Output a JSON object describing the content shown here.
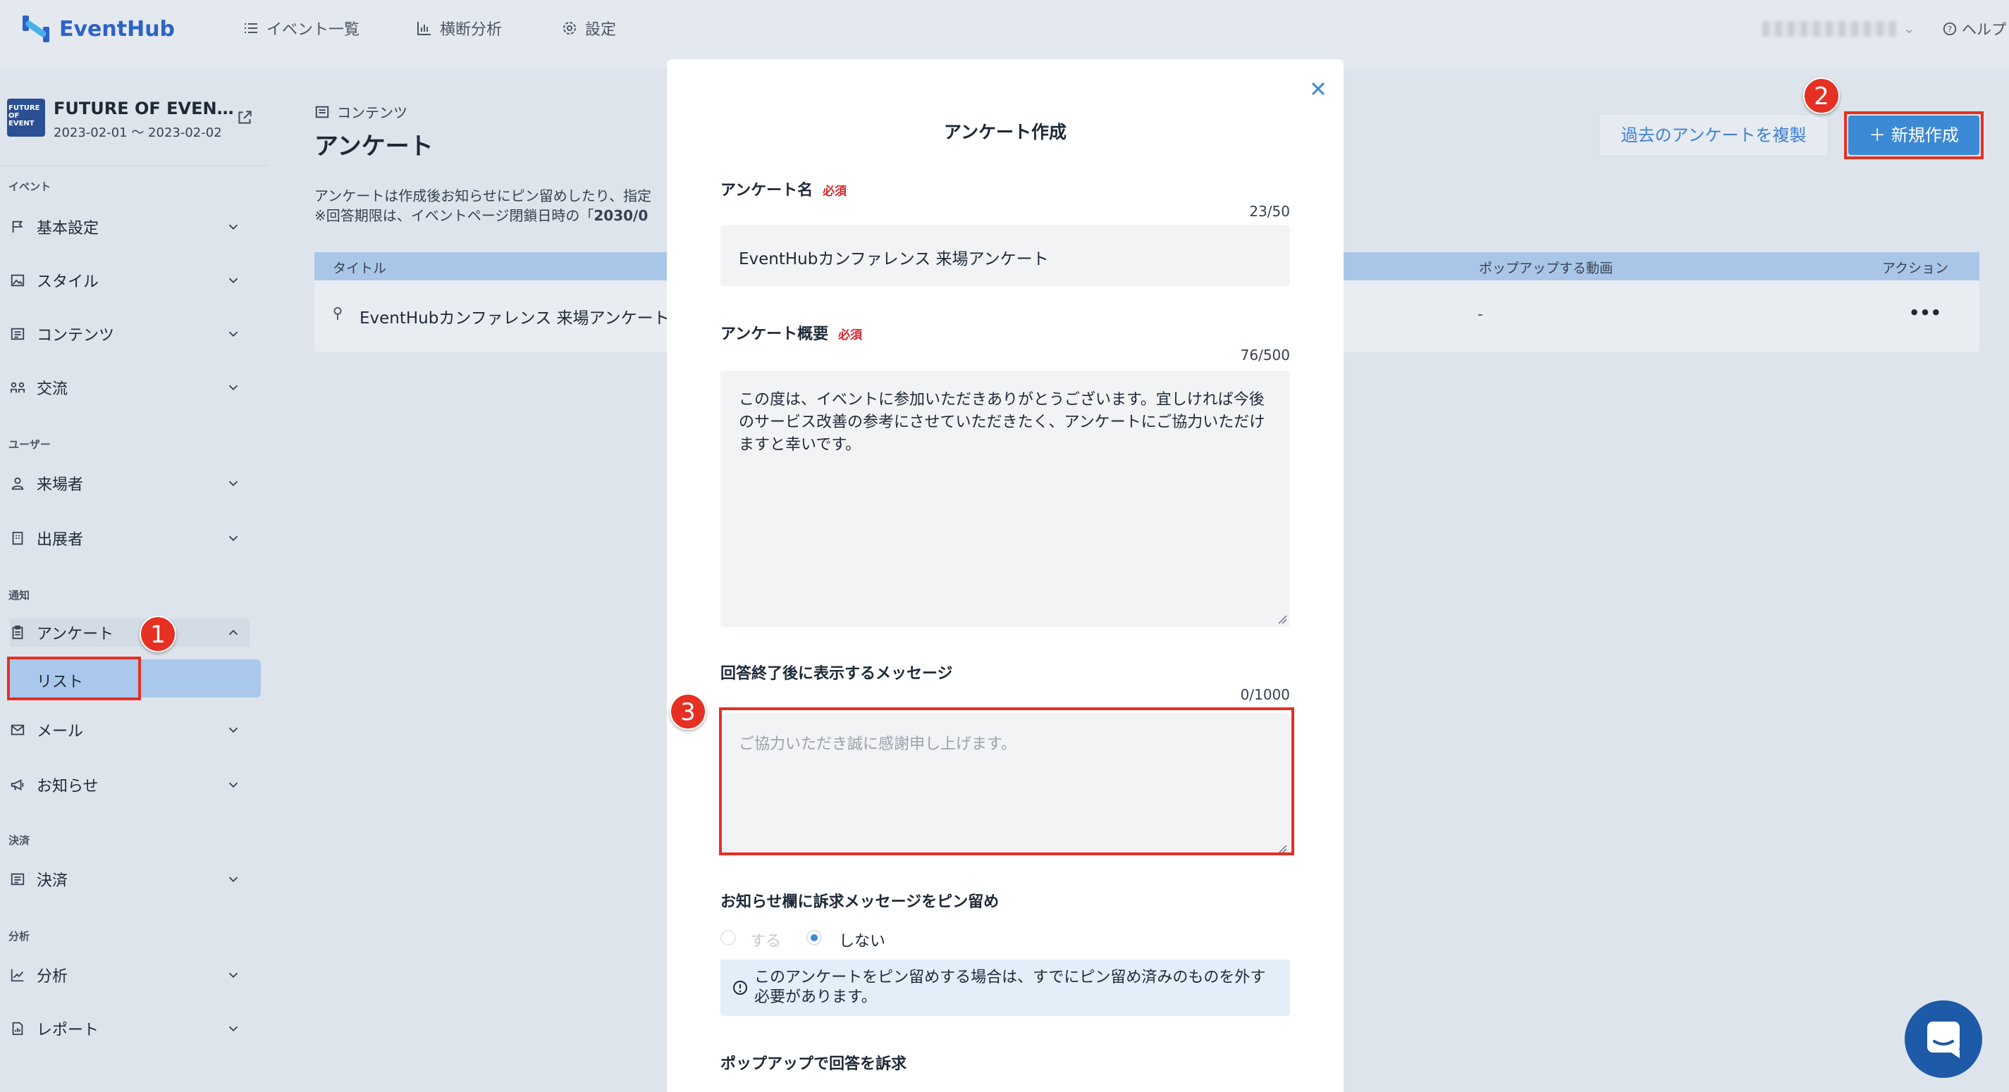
{
  "header": {
    "logo_text": "EventHub",
    "nav": [
      {
        "label": "イベント一覧",
        "icon": "list-icon"
      },
      {
        "label": "横断分析",
        "icon": "bar-chart-icon"
      },
      {
        "label": "設定",
        "icon": "gear-icon"
      }
    ],
    "help_label": "ヘルプ"
  },
  "event": {
    "thumb_text": "FUTURE OF EVENT",
    "title": "FUTURE OF EVEN…",
    "dates": "2023-02-01 ～ 2023-02-02"
  },
  "sidebar": {
    "sections": [
      {
        "label": "イベント"
      },
      {
        "label": "ユーザー"
      },
      {
        "label": "通知"
      },
      {
        "label": "決済"
      },
      {
        "label": "分析"
      }
    ],
    "items": [
      {
        "label": "基本設定",
        "icon": "flag-icon"
      },
      {
        "label": "スタイル",
        "icon": "image-icon"
      },
      {
        "label": "コンテンツ",
        "icon": "content-icon"
      },
      {
        "label": "交流",
        "icon": "exchange-icon"
      },
      {
        "label": "来場者",
        "icon": "user-icon"
      },
      {
        "label": "出展者",
        "icon": "building-icon"
      },
      {
        "label": "アンケート",
        "icon": "clipboard-icon"
      },
      {
        "label": "メール",
        "icon": "mail-icon"
      },
      {
        "label": "お知らせ",
        "icon": "megaphone-icon"
      },
      {
        "label": "決済",
        "icon": "receipt-icon"
      },
      {
        "label": "分析",
        "icon": "line-chart-icon"
      },
      {
        "label": "レポート",
        "icon": "report-icon"
      }
    ],
    "sub_item": "リスト"
  },
  "annotations": {
    "one": "1",
    "two": "2",
    "three": "3"
  },
  "main": {
    "breadcrumb": "コンテンツ",
    "title": "アンケート",
    "desc1": "アンケートは作成後お知らせにピン留めしたり、指定",
    "desc2_prefix": "※回答期限は、イベントページ閉鎖日時の「",
    "desc2_bold": "2030/0",
    "btn_copy": "過去のアンケートを複製",
    "btn_new": "＋ 新規作成",
    "table": {
      "headers": {
        "title": "タイトル",
        "popup_video": "ポップアップする動画",
        "action": "アクション"
      },
      "rows": [
        {
          "title": "EventHubカンファレンス 来場アンケート",
          "popup_video": "-",
          "action": "•••"
        }
      ]
    }
  },
  "modal": {
    "title": "アンケート作成",
    "required": "必須",
    "name_label": "アンケート名",
    "name_counter": "23/50",
    "name_value": "EventHubカンファレンス 来場アンケート",
    "desc_label": "アンケート概要",
    "desc_counter": "76/500",
    "desc_value": "この度は、イベントに参加いただきありがとうございます。宜しければ今後のサービス改善の参考にさせていただきたく、アンケートにご協力いただけますと幸いです。",
    "msg_label": "回答終了後に表示するメッセージ",
    "msg_counter": "0/1000",
    "msg_placeholder": "ご協力いただき誠に感謝申し上げます。",
    "pin_label": "お知らせ欄に訴求メッセージをピン留め",
    "pin_yes": "する",
    "pin_no": "しない",
    "info_line1": "このアンケートをピン留めする場合は、すでにピン留め済みのものを外す",
    "info_line2": "必要があります。",
    "popup_label": "ポップアップで回答を訴求"
  }
}
